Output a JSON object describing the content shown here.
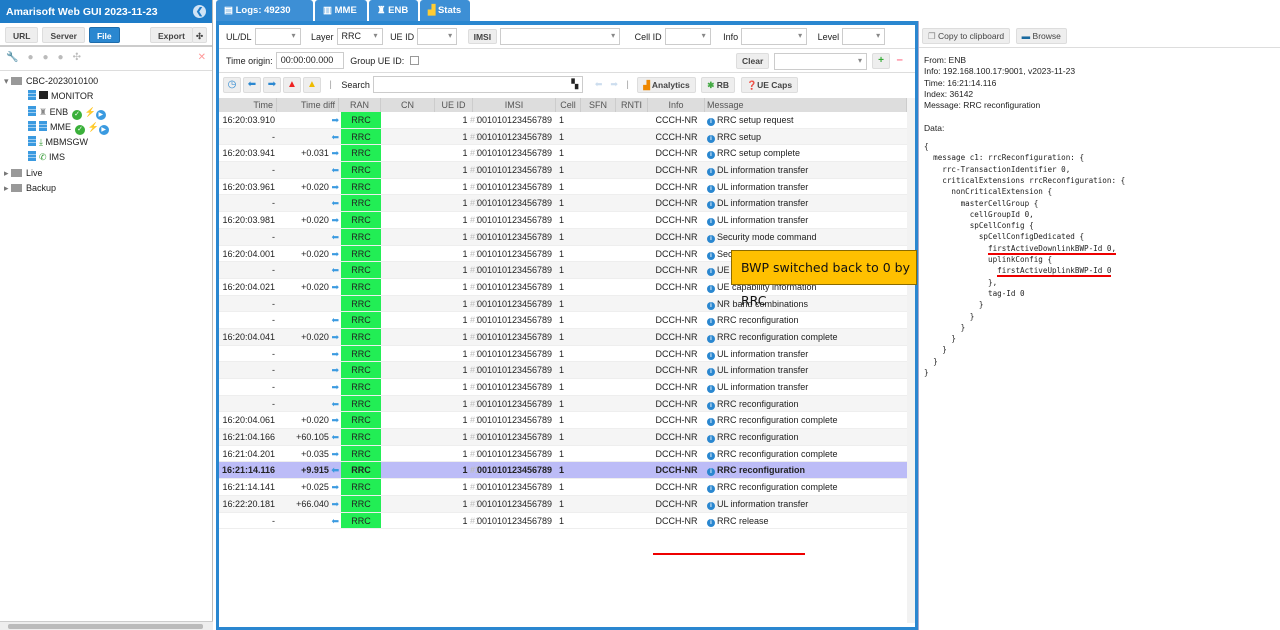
{
  "app": {
    "title": "Amarisoft Web GUI 2023-11-23"
  },
  "left": {
    "buttons": [
      "URL",
      "Server",
      "File"
    ],
    "export": "Export",
    "tree": {
      "root": "CBC-2023010100",
      "nodes": [
        "MONITOR",
        "ENB",
        "MME",
        "MBMSGW",
        "IMS"
      ],
      "folders": [
        "Live",
        "Backup"
      ]
    }
  },
  "tabs": [
    "Logs: 49230",
    "MME",
    "ENB",
    "Stats"
  ],
  "filters": {
    "uldl_label": "UL/DL",
    "uldl_value": "",
    "layer_label": "Layer",
    "layer_value": "RRC",
    "ueid_label": "UE ID",
    "ueid_value": "",
    "imsi_button": "IMSI",
    "imsi_value": "",
    "cellid_label": "Cell ID",
    "info_label": "Info",
    "level_label": "Level",
    "time_origin_label": "Time origin:",
    "time_origin_value": "00:00:00.000",
    "group_ueid_label": "Group UE ID:",
    "clear": "Clear"
  },
  "toolbar": {
    "search_label": "Search",
    "search_value": "",
    "analytics": "Analytics",
    "rb": "RB",
    "uecaps": "UE Caps"
  },
  "columns": [
    "Time",
    "Time diff",
    "RAN",
    "CN",
    "UE ID",
    "IMSI",
    "Cell",
    "SFN",
    "RNTI",
    "Info",
    "Message"
  ],
  "rows": [
    {
      "time": "16:20:03.910",
      "diff": "",
      "dir": "ul",
      "ran": "RRC",
      "ue": "1",
      "ueidx": "#1",
      "imsi": "001010123456789",
      "cell": "1",
      "info": "CCCH-NR",
      "msg": "RRC setup request"
    },
    {
      "time": "-",
      "diff": "",
      "dir": "dl",
      "ran": "RRC",
      "ue": "1",
      "ueidx": "#1",
      "imsi": "001010123456789",
      "cell": "1",
      "info": "CCCH-NR",
      "msg": "RRC setup"
    },
    {
      "time": "16:20:03.941",
      "diff": "+0.031",
      "dir": "ul",
      "ran": "RRC",
      "ue": "1",
      "ueidx": "#1",
      "imsi": "001010123456789",
      "cell": "1",
      "info": "DCCH-NR",
      "msg": "RRC setup complete"
    },
    {
      "time": "-",
      "diff": "",
      "dir": "dl",
      "ran": "RRC",
      "ue": "1",
      "ueidx": "#1",
      "imsi": "001010123456789",
      "cell": "1",
      "info": "DCCH-NR",
      "msg": "DL information transfer"
    },
    {
      "time": "16:20:03.961",
      "diff": "+0.020",
      "dir": "ul",
      "ran": "RRC",
      "ue": "1",
      "ueidx": "#1",
      "imsi": "001010123456789",
      "cell": "1",
      "info": "DCCH-NR",
      "msg": "UL information transfer"
    },
    {
      "time": "-",
      "diff": "",
      "dir": "dl",
      "ran": "RRC",
      "ue": "1",
      "ueidx": "#1",
      "imsi": "001010123456789",
      "cell": "1",
      "info": "DCCH-NR",
      "msg": "DL information transfer"
    },
    {
      "time": "16:20:03.981",
      "diff": "+0.020",
      "dir": "ul",
      "ran": "RRC",
      "ue": "1",
      "ueidx": "#1",
      "imsi": "001010123456789",
      "cell": "1",
      "info": "DCCH-NR",
      "msg": "UL information transfer"
    },
    {
      "time": "-",
      "diff": "",
      "dir": "dl",
      "ran": "RRC",
      "ue": "1",
      "ueidx": "#1",
      "imsi": "001010123456789",
      "cell": "1",
      "info": "DCCH-NR",
      "msg": "Security mode command"
    },
    {
      "time": "16:20:04.001",
      "diff": "+0.020",
      "dir": "ul",
      "ran": "RRC",
      "ue": "1",
      "ueidx": "#1",
      "imsi": "001010123456789",
      "cell": "1",
      "info": "DCCH-NR",
      "msg": "Security mode complete"
    },
    {
      "time": "-",
      "diff": "",
      "dir": "dl",
      "ran": "RRC",
      "ue": "1",
      "ueidx": "#1",
      "imsi": "001010123456789",
      "cell": "1",
      "info": "DCCH-NR",
      "msg": "UE capability enquiry"
    },
    {
      "time": "16:20:04.021",
      "diff": "+0.020",
      "dir": "ul",
      "ran": "RRC",
      "ue": "1",
      "ueidx": "#1",
      "imsi": "001010123456789",
      "cell": "1",
      "info": "DCCH-NR",
      "msg": "UE capability information"
    },
    {
      "time": "-",
      "diff": "",
      "dir": "",
      "ran": "RRC",
      "ue": "1",
      "ueidx": "#1",
      "imsi": "001010123456789",
      "cell": "1",
      "info": "",
      "msg": "NR band combinations"
    },
    {
      "time": "-",
      "diff": "",
      "dir": "dl",
      "ran": "RRC",
      "ue": "1",
      "ueidx": "#1",
      "imsi": "001010123456789",
      "cell": "1",
      "info": "DCCH-NR",
      "msg": "RRC reconfiguration"
    },
    {
      "time": "16:20:04.041",
      "diff": "+0.020",
      "dir": "ul",
      "ran": "RRC",
      "ue": "1",
      "ueidx": "#1",
      "imsi": "001010123456789",
      "cell": "1",
      "info": "DCCH-NR",
      "msg": "RRC reconfiguration complete"
    },
    {
      "time": "-",
      "diff": "",
      "dir": "ul",
      "ran": "RRC",
      "ue": "1",
      "ueidx": "#1",
      "imsi": "001010123456789",
      "cell": "1",
      "info": "DCCH-NR",
      "msg": "UL information transfer"
    },
    {
      "time": "-",
      "diff": "",
      "dir": "ul",
      "ran": "RRC",
      "ue": "1",
      "ueidx": "#1",
      "imsi": "001010123456789",
      "cell": "1",
      "info": "DCCH-NR",
      "msg": "UL information transfer"
    },
    {
      "time": "-",
      "diff": "",
      "dir": "ul",
      "ran": "RRC",
      "ue": "1",
      "ueidx": "#1",
      "imsi": "001010123456789",
      "cell": "1",
      "info": "DCCH-NR",
      "msg": "UL information transfer"
    },
    {
      "time": "-",
      "diff": "",
      "dir": "dl",
      "ran": "RRC",
      "ue": "1",
      "ueidx": "#1",
      "imsi": "001010123456789",
      "cell": "1",
      "info": "DCCH-NR",
      "msg": "RRC reconfiguration"
    },
    {
      "time": "16:20:04.061",
      "diff": "+0.020",
      "dir": "ul",
      "ran": "RRC",
      "ue": "1",
      "ueidx": "#1",
      "imsi": "001010123456789",
      "cell": "1",
      "info": "DCCH-NR",
      "msg": "RRC reconfiguration complete"
    },
    {
      "time": "16:21:04.166",
      "diff": "+60.105",
      "dir": "dl",
      "ran": "RRC",
      "ue": "1",
      "ueidx": "#1",
      "imsi": "001010123456789",
      "cell": "1",
      "info": "DCCH-NR",
      "msg": "RRC reconfiguration"
    },
    {
      "time": "16:21:04.201",
      "diff": "+0.035",
      "dir": "ul",
      "ran": "RRC",
      "ue": "1",
      "ueidx": "#1",
      "imsi": "001010123456789",
      "cell": "1",
      "info": "DCCH-NR",
      "msg": "RRC reconfiguration complete"
    },
    {
      "time": "16:21:14.116",
      "diff": "+9.915",
      "dir": "dl",
      "ran": "RRC",
      "ue": "1",
      "ueidx": "#1",
      "imsi": "001010123456789",
      "cell": "1",
      "info": "DCCH-NR",
      "msg": "RRC reconfiguration",
      "selected": true
    },
    {
      "time": "16:21:14.141",
      "diff": "+0.025",
      "dir": "ul",
      "ran": "RRC",
      "ue": "1",
      "ueidx": "#1",
      "imsi": "001010123456789",
      "cell": "1",
      "info": "DCCH-NR",
      "msg": "RRC reconfiguration complete"
    },
    {
      "time": "16:22:20.181",
      "diff": "+66.040",
      "dir": "ul",
      "ran": "RRC",
      "ue": "1",
      "ueidx": "#1",
      "imsi": "001010123456789",
      "cell": "1",
      "info": "DCCH-NR",
      "msg": "UL information transfer"
    },
    {
      "time": "-",
      "diff": "",
      "dir": "dl",
      "ran": "RRC",
      "ue": "1",
      "ueidx": "#1",
      "imsi": "001010123456789",
      "cell": "1",
      "info": "DCCH-NR",
      "msg": "RRC release"
    }
  ],
  "callout": "BWP switched back to 0 by RRC",
  "detail": {
    "copy": "Copy to clipboard",
    "browse": "Browse",
    "meta": [
      "From: ENB",
      "Info: 192.168.100.17:9001, v2023-11-23",
      "Time: 16:21:14.116",
      "Index: 36142",
      "Message: RRC reconfiguration",
      "",
      "Data:"
    ],
    "code": [
      "{",
      "  message c1: rrcReconfiguration: {",
      "    rrc-TransactionIdentifier 0,",
      "    criticalExtensions rrcReconfiguration: {",
      "      nonCriticalExtension {",
      "        masterCellGroup {",
      "          cellGroupId 0,",
      "          spCellConfig {",
      "            spCellConfigDedicated {",
      "              firstActiveDownlinkBWP-Id 0,",
      "              uplinkConfig {",
      "                firstActiveUplinkBWP-Id 0",
      "              },",
      "              tag-Id 0",
      "            }",
      "          }",
      "        }",
      "      }",
      "    }",
      "  }",
      "}"
    ],
    "highlight_lines": [
      9,
      11
    ]
  },
  "colors": {
    "accent": "#1e7cc8",
    "ran": "#22ee55",
    "selected": "#bcbcf7",
    "callout": "#ffc000",
    "underline": "#ee0000"
  }
}
